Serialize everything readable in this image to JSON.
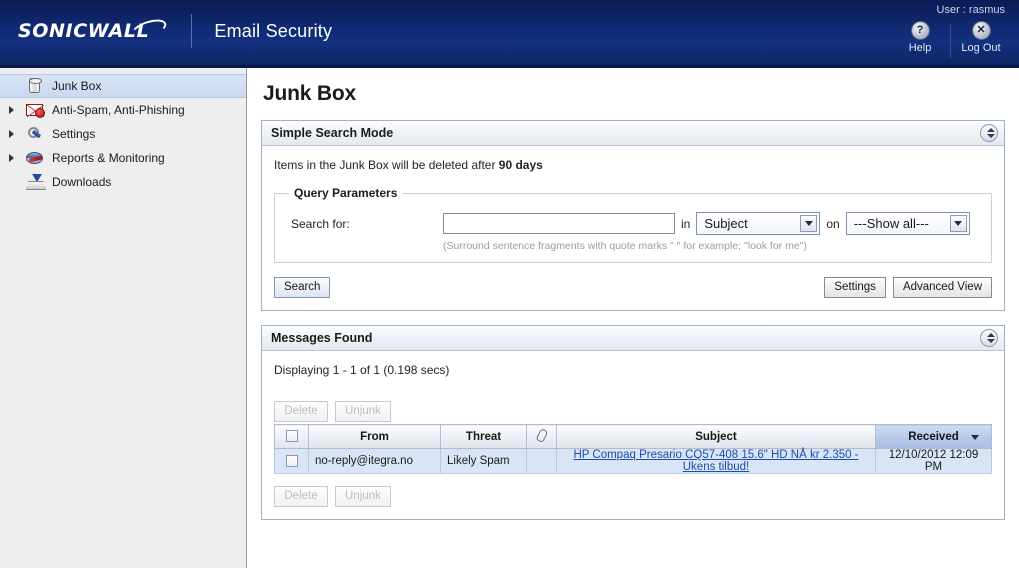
{
  "header": {
    "brand": "SONICWALL",
    "product": "Email Security",
    "user_line": "User : rasmus",
    "help_label": "Help",
    "help_glyph": "?",
    "logout_label": "Log Out",
    "logout_glyph": "✕",
    "brand_bg": "#102a73"
  },
  "sidebar": {
    "items": [
      {
        "label": "Junk Box",
        "icon": "junk-box-icon",
        "selected": true,
        "expandable": false
      },
      {
        "label": "Anti-Spam, Anti-Phishing",
        "icon": "anti-spam-envelope-icon",
        "selected": false,
        "expandable": true
      },
      {
        "label": "Settings",
        "icon": "wrench-icon",
        "selected": false,
        "expandable": true
      },
      {
        "label": "Reports & Monitoring",
        "icon": "globe-icon",
        "selected": false,
        "expandable": true
      },
      {
        "label": "Downloads",
        "icon": "download-icon",
        "selected": false,
        "expandable": false
      }
    ]
  },
  "main": {
    "page_title": "Junk Box",
    "search_panel": {
      "title": "Simple Search Mode",
      "retention_prefix": "Items in the Junk Box will be deleted after ",
      "retention_value": "90 days",
      "fieldset_legend": "Query Parameters",
      "search_for_label": "Search for:",
      "search_input_value": "",
      "search_input_placeholder": "",
      "in_label": "in",
      "field_select_value": "Subject",
      "on_label": "on",
      "date_select_value": "---Show all---",
      "hint": "(Surround sentence fragments with quote marks \" \" for example; \"look for me\")",
      "search_button": "Search",
      "settings_button": "Settings",
      "advanced_view_button": "Advanced View"
    },
    "results_panel": {
      "title": "Messages Found",
      "displaying": "Displaying 1 - 1 of 1 (0.198 secs)",
      "delete_button": "Delete",
      "unjunk_button": "Unjunk",
      "columns": [
        "",
        "From",
        "Threat",
        "",
        "Subject",
        "Received"
      ],
      "sort_column": "Received",
      "rows": [
        {
          "checked": false,
          "from": "no-reply@itegra.no",
          "threat": "Likely Spam",
          "attachment": "",
          "subject": "HP Compaq Presario CQ57-408 15.6\" HD NÅ kr 2.350 - Ukens tilbud!",
          "received": "12/10/2012 12:09 PM"
        }
      ]
    }
  }
}
